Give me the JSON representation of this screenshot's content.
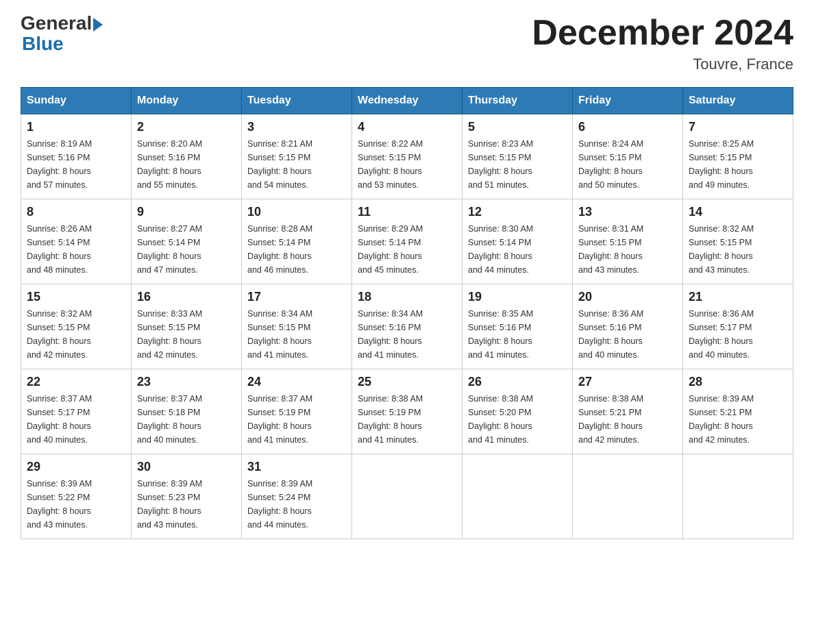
{
  "header": {
    "logo_general": "General",
    "logo_blue": "Blue",
    "title": "December 2024",
    "subtitle": "Touvre, France"
  },
  "days_of_week": [
    "Sunday",
    "Monday",
    "Tuesday",
    "Wednesday",
    "Thursday",
    "Friday",
    "Saturday"
  ],
  "weeks": [
    [
      {
        "day": "1",
        "sunrise": "8:19 AM",
        "sunset": "5:16 PM",
        "daylight": "8 hours and 57 minutes."
      },
      {
        "day": "2",
        "sunrise": "8:20 AM",
        "sunset": "5:16 PM",
        "daylight": "8 hours and 55 minutes."
      },
      {
        "day": "3",
        "sunrise": "8:21 AM",
        "sunset": "5:15 PM",
        "daylight": "8 hours and 54 minutes."
      },
      {
        "day": "4",
        "sunrise": "8:22 AM",
        "sunset": "5:15 PM",
        "daylight": "8 hours and 53 minutes."
      },
      {
        "day": "5",
        "sunrise": "8:23 AM",
        "sunset": "5:15 PM",
        "daylight": "8 hours and 51 minutes."
      },
      {
        "day": "6",
        "sunrise": "8:24 AM",
        "sunset": "5:15 PM",
        "daylight": "8 hours and 50 minutes."
      },
      {
        "day": "7",
        "sunrise": "8:25 AM",
        "sunset": "5:15 PM",
        "daylight": "8 hours and 49 minutes."
      }
    ],
    [
      {
        "day": "8",
        "sunrise": "8:26 AM",
        "sunset": "5:14 PM",
        "daylight": "8 hours and 48 minutes."
      },
      {
        "day": "9",
        "sunrise": "8:27 AM",
        "sunset": "5:14 PM",
        "daylight": "8 hours and 47 minutes."
      },
      {
        "day": "10",
        "sunrise": "8:28 AM",
        "sunset": "5:14 PM",
        "daylight": "8 hours and 46 minutes."
      },
      {
        "day": "11",
        "sunrise": "8:29 AM",
        "sunset": "5:14 PM",
        "daylight": "8 hours and 45 minutes."
      },
      {
        "day": "12",
        "sunrise": "8:30 AM",
        "sunset": "5:14 PM",
        "daylight": "8 hours and 44 minutes."
      },
      {
        "day": "13",
        "sunrise": "8:31 AM",
        "sunset": "5:15 PM",
        "daylight": "8 hours and 43 minutes."
      },
      {
        "day": "14",
        "sunrise": "8:32 AM",
        "sunset": "5:15 PM",
        "daylight": "8 hours and 43 minutes."
      }
    ],
    [
      {
        "day": "15",
        "sunrise": "8:32 AM",
        "sunset": "5:15 PM",
        "daylight": "8 hours and 42 minutes."
      },
      {
        "day": "16",
        "sunrise": "8:33 AM",
        "sunset": "5:15 PM",
        "daylight": "8 hours and 42 minutes."
      },
      {
        "day": "17",
        "sunrise": "8:34 AM",
        "sunset": "5:15 PM",
        "daylight": "8 hours and 41 minutes."
      },
      {
        "day": "18",
        "sunrise": "8:34 AM",
        "sunset": "5:16 PM",
        "daylight": "8 hours and 41 minutes."
      },
      {
        "day": "19",
        "sunrise": "8:35 AM",
        "sunset": "5:16 PM",
        "daylight": "8 hours and 41 minutes."
      },
      {
        "day": "20",
        "sunrise": "8:36 AM",
        "sunset": "5:16 PM",
        "daylight": "8 hours and 40 minutes."
      },
      {
        "day": "21",
        "sunrise": "8:36 AM",
        "sunset": "5:17 PM",
        "daylight": "8 hours and 40 minutes."
      }
    ],
    [
      {
        "day": "22",
        "sunrise": "8:37 AM",
        "sunset": "5:17 PM",
        "daylight": "8 hours and 40 minutes."
      },
      {
        "day": "23",
        "sunrise": "8:37 AM",
        "sunset": "5:18 PM",
        "daylight": "8 hours and 40 minutes."
      },
      {
        "day": "24",
        "sunrise": "8:37 AM",
        "sunset": "5:19 PM",
        "daylight": "8 hours and 41 minutes."
      },
      {
        "day": "25",
        "sunrise": "8:38 AM",
        "sunset": "5:19 PM",
        "daylight": "8 hours and 41 minutes."
      },
      {
        "day": "26",
        "sunrise": "8:38 AM",
        "sunset": "5:20 PM",
        "daylight": "8 hours and 41 minutes."
      },
      {
        "day": "27",
        "sunrise": "8:38 AM",
        "sunset": "5:21 PM",
        "daylight": "8 hours and 42 minutes."
      },
      {
        "day": "28",
        "sunrise": "8:39 AM",
        "sunset": "5:21 PM",
        "daylight": "8 hours and 42 minutes."
      }
    ],
    [
      {
        "day": "29",
        "sunrise": "8:39 AM",
        "sunset": "5:22 PM",
        "daylight": "8 hours and 43 minutes."
      },
      {
        "day": "30",
        "sunrise": "8:39 AM",
        "sunset": "5:23 PM",
        "daylight": "8 hours and 43 minutes."
      },
      {
        "day": "31",
        "sunrise": "8:39 AM",
        "sunset": "5:24 PM",
        "daylight": "8 hours and 44 minutes."
      },
      null,
      null,
      null,
      null
    ]
  ],
  "labels": {
    "sunrise": "Sunrise:",
    "sunset": "Sunset:",
    "daylight": "Daylight:"
  }
}
